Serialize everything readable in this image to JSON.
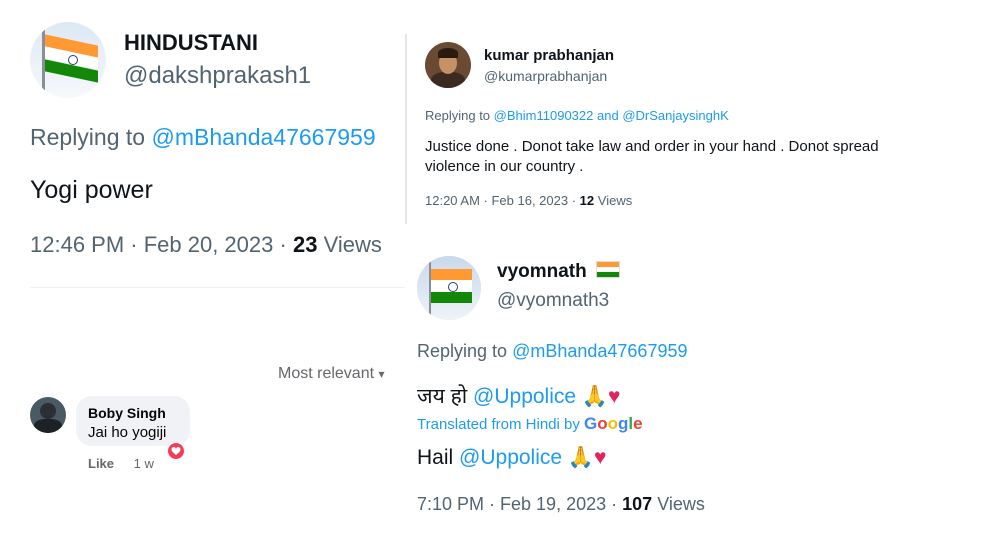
{
  "tweet1": {
    "name": "HINDUSTANI",
    "handle": "@dakshprakash1",
    "replying_prefix": "Replying to",
    "replying_to": "@mBhanda47667959",
    "text": "Yogi power",
    "meta_time": "12:46 PM · Feb 20, 2023 ·",
    "views_count": "23",
    "views_label": "Views"
  },
  "tweet2": {
    "name": "kumar prabhanjan",
    "handle": "@kumarprabhanjan",
    "replying_prefix": "Replying to",
    "replying_to_1": "@Bhim11090322",
    "and": "and",
    "replying_to_2": "@DrSanjaysinghK",
    "text_line1": "Justice done . Donot take law and order in your hand . Donot spread",
    "text_line2": "violence in our country .",
    "meta_time": "12:20 AM · Feb 16, 2023 ·",
    "views_count": "12",
    "views_label": "Views"
  },
  "tweet3": {
    "name": "vyomnath",
    "name_emoji": "🇮🇳",
    "handle": "@vyomnath3",
    "replying_prefix": "Replying to",
    "replying_to": "@mBhanda47667959",
    "hindi_prefix": "जय हो",
    "mention": "@Uppolice",
    "emojis": "🙏♥",
    "translated_label": "Translated from Hindi by",
    "google": [
      "G",
      "o",
      "o",
      "g",
      "l",
      "e"
    ],
    "translated_prefix": "Hail",
    "meta_time": "7:10 PM · Feb 19, 2023 ·",
    "views_count": "107",
    "views_label": "Views"
  },
  "fb": {
    "sort_label": "Most relevant",
    "sort_icon": "▾",
    "commenter": "Boby Singh",
    "comment": "Jai ho yogiji",
    "like": "Like",
    "age": "1 w",
    "reaction_icon": "heart-icon"
  },
  "colors": {
    "twitter_blue": "#1d9bf0",
    "muted": "#536471",
    "saffron": "#ff9933",
    "green": "#138808",
    "heart_red": "#e0245e"
  }
}
